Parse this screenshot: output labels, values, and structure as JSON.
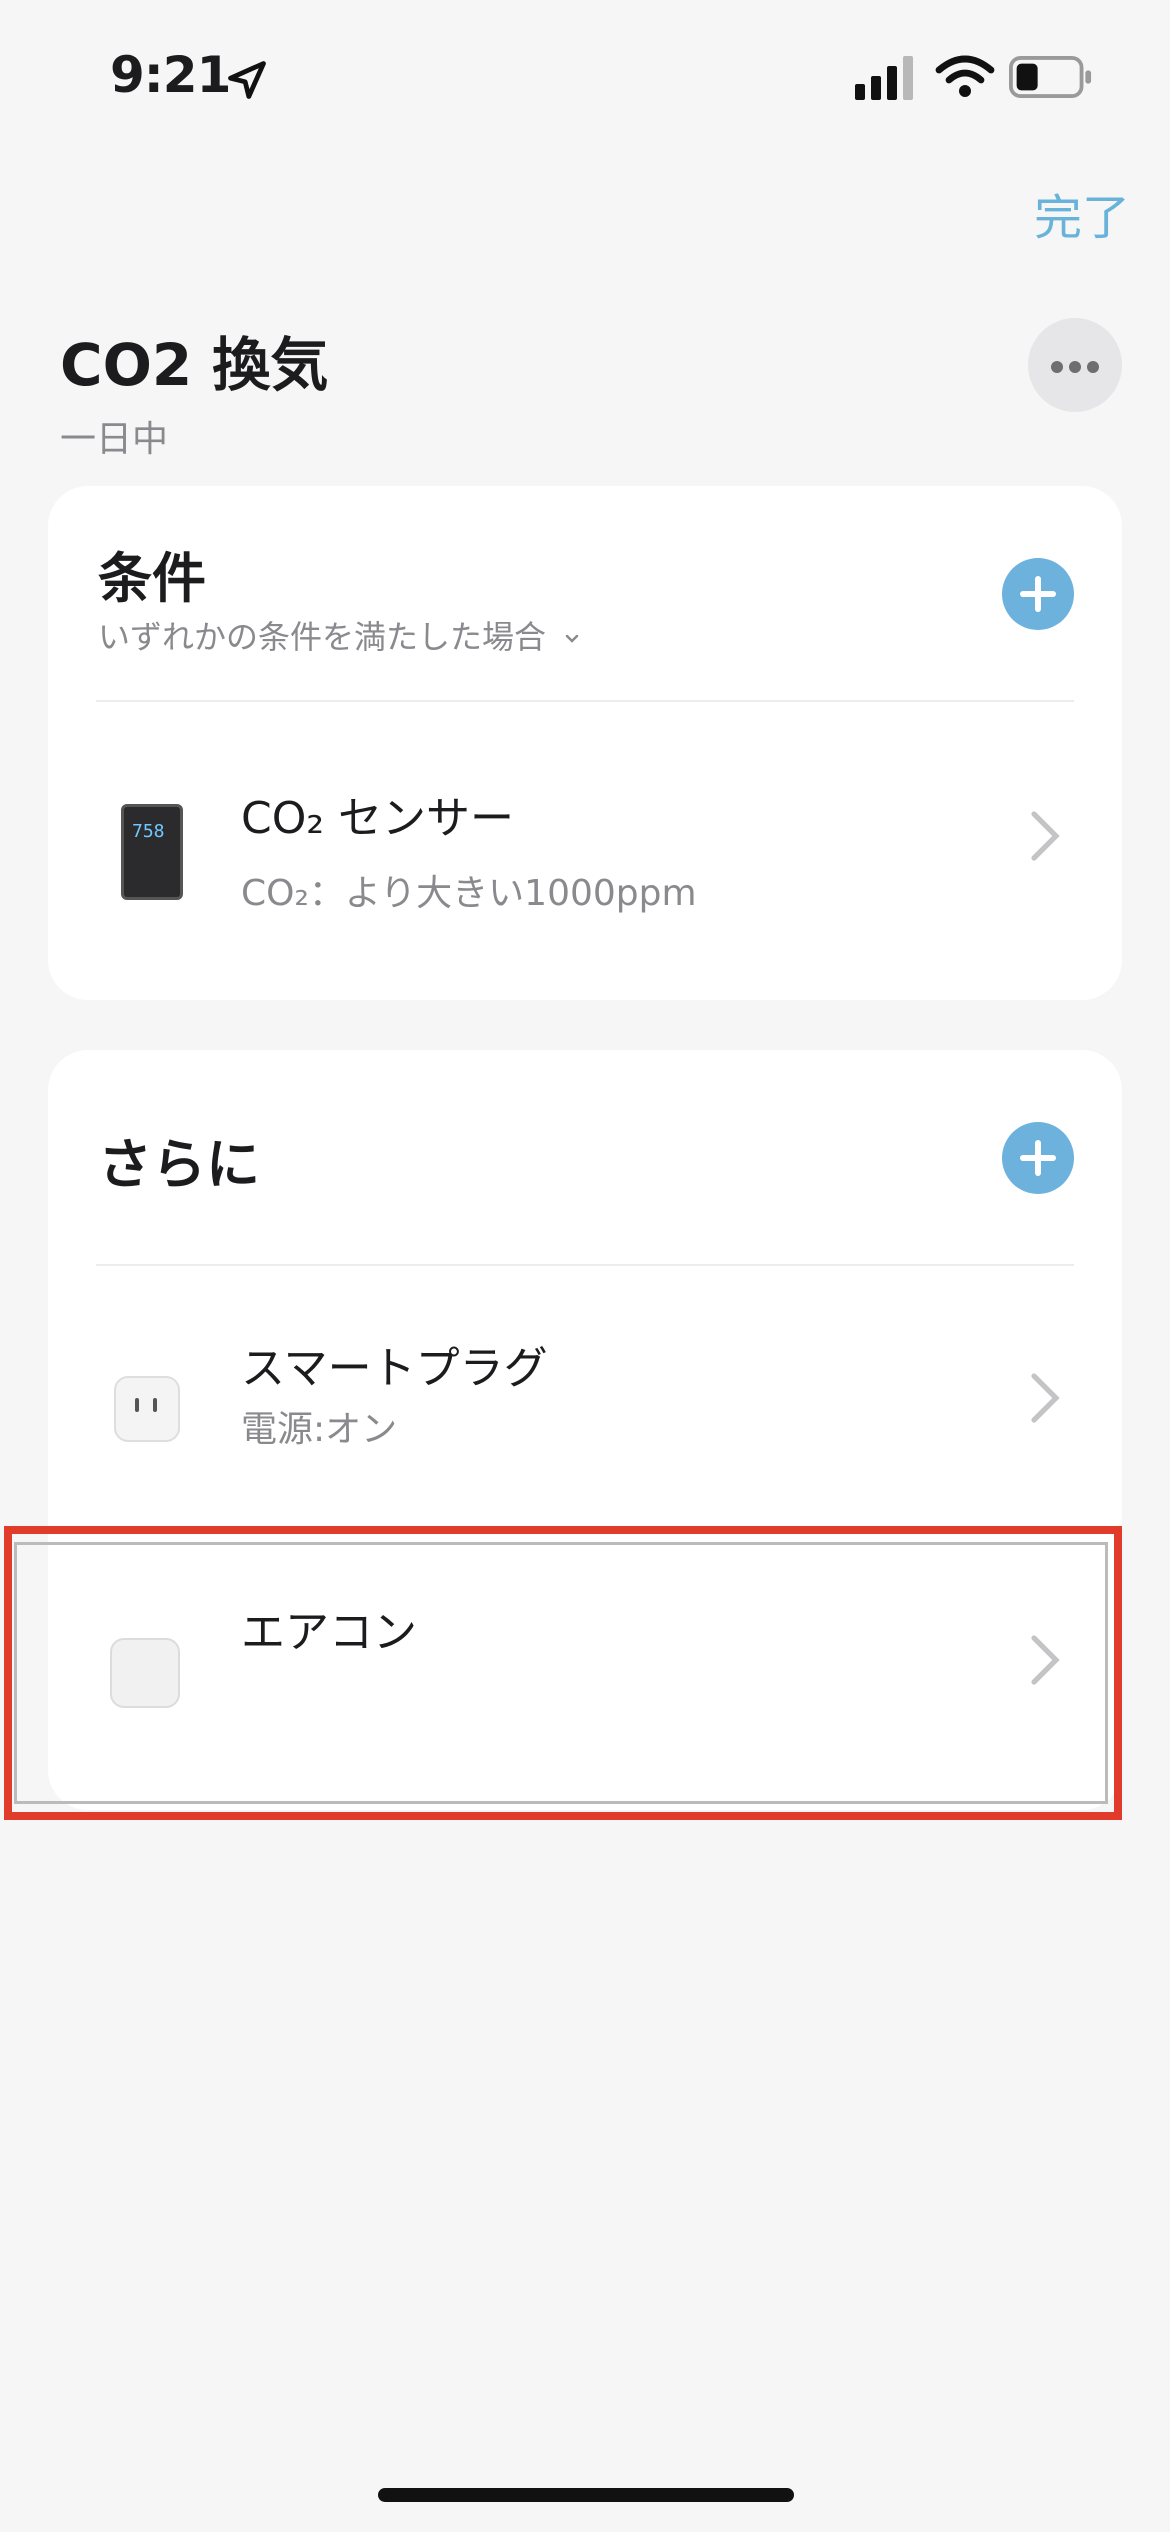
{
  "status_bar": {
    "time": "9:21"
  },
  "header": {
    "done_label": "完了"
  },
  "scene": {
    "title": "CO2 換気",
    "subtitle": "一日中"
  },
  "conditions": {
    "title": "条件",
    "mode": "いずれかの条件を満たした場合",
    "items": [
      {
        "name": "CO₂ センサー",
        "detail": "CO₂：より大きい1000ppm",
        "device_screen": "758"
      }
    ]
  },
  "actions": {
    "title": "さらに",
    "items": [
      {
        "name": "スマートプラグ",
        "detail": "電源:オン"
      },
      {
        "name": "エアコン",
        "detail": ""
      }
    ]
  },
  "colors": {
    "accent": "#69b3da",
    "highlight": "#e03b2b"
  }
}
